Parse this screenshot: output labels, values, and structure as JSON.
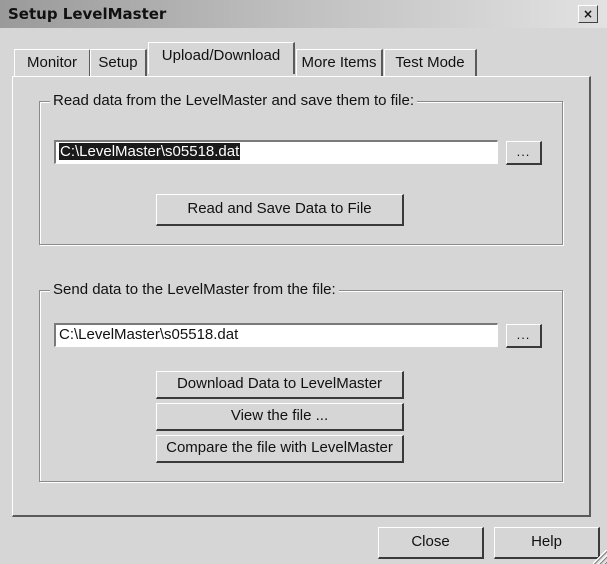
{
  "window": {
    "title": "Setup LevelMaster",
    "close_glyph": "×"
  },
  "tabs": [
    {
      "label": "Monitor",
      "active": false
    },
    {
      "label": "Setup",
      "active": false
    },
    {
      "label": "Upload/Download",
      "active": true
    },
    {
      "label": "More Items",
      "active": false
    },
    {
      "label": "Test Mode",
      "active": false
    }
  ],
  "read_group": {
    "label": "Read data from the LevelMaster and save them to file:",
    "file_path": "C:\\LevelMaster\\s05518.dat",
    "browse_label": "...",
    "action_label": "Read and Save Data to File"
  },
  "send_group": {
    "label": "Send data to the LevelMaster from the file:",
    "file_path": "C:\\LevelMaster\\s05518.dat",
    "browse_label": "...",
    "download_label": "Download Data to LevelMaster",
    "view_label": "View the file ...",
    "compare_label": "Compare the file with LevelMaster"
  },
  "footer": {
    "close_label": "Close",
    "help_label": "Help"
  }
}
